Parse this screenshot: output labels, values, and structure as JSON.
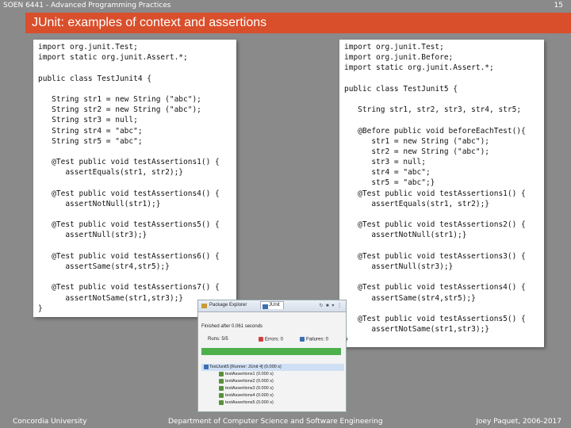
{
  "header": {
    "course": "SOEN 6441 - Advanced Programming Practices",
    "page_number": "15"
  },
  "slide": {
    "title": "JUnit: examples of context and assertions"
  },
  "code_left": {
    "lines": [
      "import org.junit.Test;",
      "import static org.junit.Assert.*;",
      "",
      "public class TestJunit4 {",
      "",
      "   String str1 = new String (\"abc\");",
      "   String str2 = new String (\"abc\");",
      "   String str3 = null;",
      "   String str4 = \"abc\";",
      "   String str5 = \"abc\";",
      "",
      "   @Test public void testAssertions1() {",
      "      assertEquals(str1, str2);}",
      "",
      "   @Test public void testAssertions4() {",
      "      assertNotNull(str1);}",
      "",
      "   @Test public void testAssertions5() {",
      "      assertNull(str3);}",
      "",
      "   @Test public void testAssertions6() {",
      "      assertSame(str4,str5);}",
      "",
      "   @Test public void testAssertions7() {",
      "      assertNotSame(str1,str3);}",
      "}"
    ]
  },
  "code_right": {
    "lines": [
      "import org.junit.Test;",
      "import org.junit.Before;",
      "import static org.junit.Assert.*;",
      "",
      "public class TestJunit5 {",
      "",
      "   String str1, str2, str3, str4, str5;",
      "",
      "   @Before public void beforeEachTest(){",
      "      str1 = new String (\"abc\");",
      "      str2 = new String (\"abc\");",
      "      str3 = null;",
      "      str4 = \"abc\";",
      "      str5 = \"abc\";}",
      "   @Test public void testAssertions1() {",
      "      assertEquals(str1, str2);}",
      "",
      "   @Test public void testAssertions2() {",
      "      assertNotNull(str1);}",
      "",
      "   @Test public void testAssertions3() {",
      "      assertNull(str3);}",
      "",
      "   @Test public void testAssertions4() {",
      "      assertSame(str4,str5);}",
      "",
      "   @Test public void testAssertions5() {",
      "      assertNotSame(str1,str3);}",
      "}"
    ]
  },
  "junit_view": {
    "tab_package_explorer": "Package Explorer",
    "tab_junit": "JUnit",
    "finished": "Finished after 0.061 seconds",
    "runs": "Runs: 5/5",
    "errors": "Errors: 0",
    "failures": "Failures: 0",
    "progress_fraction": 1.0,
    "colors": {
      "pass": "#4db04d",
      "error": "#d04040",
      "failure": "#3a6fb0"
    },
    "tree": {
      "root": "TestJunit5 [Runner: JUnit 4] (0.000 s)",
      "children": [
        "testAssertions1 (0.000 s)",
        "testAssertions2 (0.000 s)",
        "testAssertions3 (0.000 s)",
        "testAssertions4 (0.000 s)",
        "testAssertions5 (0.000 s)"
      ]
    }
  },
  "footer": {
    "left": "Concordia University",
    "center": "Department of Computer Science and Software Engineering",
    "right": "Joey Paquet, 2006-2017"
  },
  "colors": {
    "background": "#8a8a8a",
    "title_bar": "#d94f2b",
    "code_bg": "#ffffff"
  }
}
